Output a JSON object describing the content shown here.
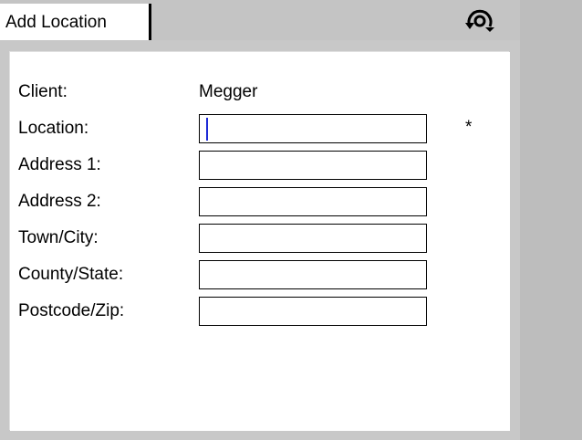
{
  "tab": {
    "title": "Add Location"
  },
  "icons": {
    "rotate": "rotate-icon"
  },
  "form": {
    "client_label": "Client:",
    "client_value": "Megger",
    "location_label": "Location:",
    "location_value": "",
    "required_marker": "*",
    "address1_label": "Address 1:",
    "address1_value": "",
    "address2_label": "Address 2:",
    "address2_value": "",
    "town_label": "Town/City:",
    "town_value": "",
    "county_label": "County/State:",
    "county_value": "",
    "postcode_label": "Postcode/Zip:",
    "postcode_value": ""
  },
  "colors": {
    "cursor": "#1f2bd6",
    "background": "#c0c0c0"
  }
}
